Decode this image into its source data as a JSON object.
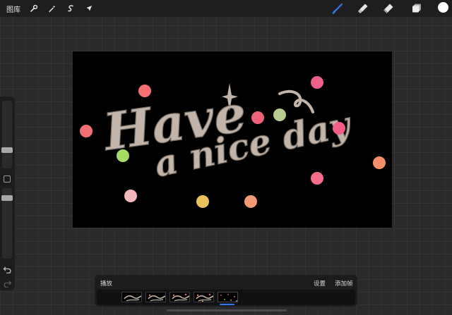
{
  "topbar": {
    "gallery_label": "图库",
    "left_tools": [
      "wrench-icon",
      "magic-wand-icon",
      "selection-icon",
      "transform-arrow-icon"
    ],
    "right_tools": [
      "brush-icon",
      "smudge-icon",
      "eraser-icon",
      "layers-icon"
    ],
    "active_tool": "brush-icon",
    "active_tool_color": "#2f7bf6",
    "current_color": "#ffffff"
  },
  "canvas": {
    "artwork_text_line1": "Have",
    "artwork_text_line2": "a nice day",
    "background_color": "#000000",
    "lettering_color": "#c2b4a8",
    "dot_colors": [
      "#f36f72",
      "#ee637b",
      "#ef5f8a",
      "#b9cc91",
      "#a5dc62",
      "#f6b7bd",
      "#ecc25c",
      "#f39a74",
      "#f48f69",
      "#f56d8a"
    ]
  },
  "animation_assist": {
    "play_label": "播放",
    "settings_label": "设置",
    "add_frame_label": "添加帧",
    "frame_count": 5,
    "selected_frame": 5,
    "selection_color": "#2f7bf6"
  }
}
